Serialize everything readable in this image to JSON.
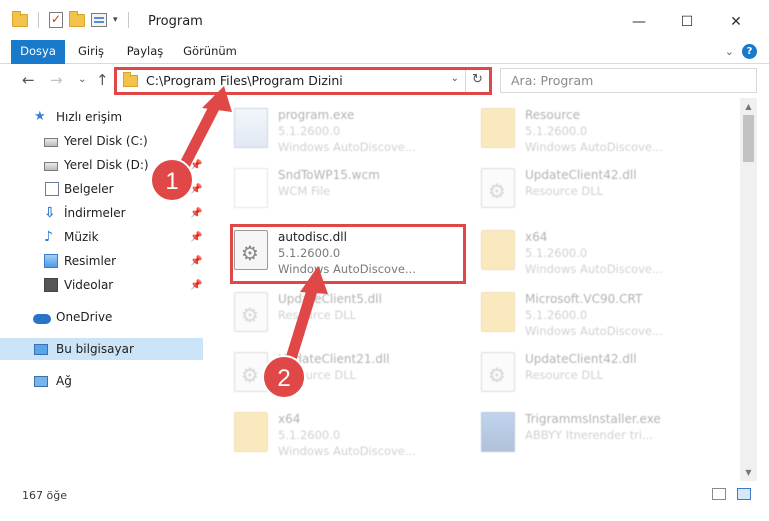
{
  "window": {
    "title": "Program",
    "minimize_icon": "minimize-icon",
    "maximize_icon": "maximize-icon",
    "close_icon": "close-icon"
  },
  "ribbon": {
    "tabs": [
      {
        "label": "Dosya",
        "active": true
      },
      {
        "label": "Giriş",
        "active": false
      },
      {
        "label": "Paylaş",
        "active": false
      },
      {
        "label": "Görünüm",
        "active": false
      }
    ],
    "help_label": "?"
  },
  "address": {
    "path": "C:\\Program Files\\Program Dizini",
    "search_placeholder": "Ara: Program"
  },
  "nav": {
    "quick_access": "Hızlı erişim",
    "items": [
      {
        "label": "Yerel Disk (C:)",
        "icon": "drive-icon",
        "pinned": true
      },
      {
        "label": "Yerel Disk (D:)",
        "icon": "drive-icon",
        "pinned": true
      },
      {
        "label": "Belgeler",
        "icon": "documents-icon",
        "pinned": true
      },
      {
        "label": "İndirmeler",
        "icon": "downloads-icon",
        "pinned": true
      },
      {
        "label": "Müzik",
        "icon": "music-icon",
        "pinned": true
      },
      {
        "label": "Resimler",
        "icon": "pictures-icon",
        "pinned": true
      },
      {
        "label": "Videolar",
        "icon": "videos-icon",
        "pinned": true
      }
    ],
    "onedrive": "OneDrive",
    "this_pc": "Bu bilgisayar",
    "network": "Ağ"
  },
  "files": {
    "left": [
      {
        "name": "program.exe",
        "line2": "5.1.2600.0",
        "line3": "Windows AutoDiscove...",
        "icon": "exe-icon"
      },
      {
        "name": "SndToWP15.wcm",
        "line2": "WCM File",
        "line3": "",
        "icon": "file-icon"
      },
      {
        "name": "autodisc.dll",
        "line2": "5.1.2600.0",
        "line3": "Windows AutoDiscove...",
        "icon": "dll-icon"
      },
      {
        "name": "UpdateClient5.dll",
        "line2": "Resource DLL",
        "line3": "",
        "icon": "dll-icon"
      },
      {
        "name": "UpdateClient21.dll",
        "line2": "Resource DLL",
        "line3": "",
        "icon": "dll-icon"
      },
      {
        "name": "x64",
        "line2": "5.1.2600.0",
        "line3": "Windows AutoDiscove...",
        "icon": "folder-icon"
      }
    ],
    "right": [
      {
        "name": "Resource",
        "line2": "5.1.2600.0",
        "line3": "Windows AutoDiscove...",
        "icon": "folder-icon"
      },
      {
        "name": "UpdateClient42.dll",
        "line2": "Resource DLL",
        "line3": "",
        "icon": "dll-icon"
      },
      {
        "name": "x64",
        "line2": "5.1.2600.0",
        "line3": "Windows AutoDiscove...",
        "icon": "folder-icon"
      },
      {
        "name": "Microsoft.VC90.CRT",
        "line2": "5.1.2600.0",
        "line3": "Windows AutoDiscove...",
        "icon": "folder-icon"
      },
      {
        "name": "UpdateClient42.dll",
        "line2": "Resource DLL",
        "line3": "",
        "icon": "dll-icon"
      },
      {
        "name": "TrigrammsInstaller.exe",
        "line2": "ABBYY Itnerender tri...",
        "line3": "",
        "icon": "exe-icon"
      }
    ]
  },
  "status": {
    "count": "167 öğe"
  },
  "annotations": {
    "step1": "1",
    "step2": "2",
    "color": "#e04848"
  }
}
